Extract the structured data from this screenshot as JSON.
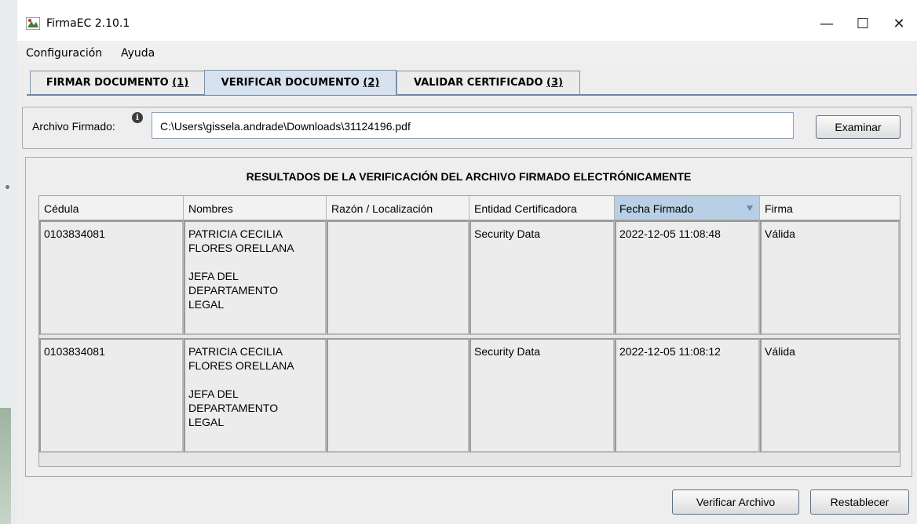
{
  "window": {
    "title": "FirmaEC 2.10.1"
  },
  "menu": {
    "configuracion": "Configuración",
    "ayuda": "Ayuda"
  },
  "tabs": [
    {
      "label": "FIRMAR DOCUMENTO",
      "shortcut": "(1)"
    },
    {
      "label": "VERIFICAR DOCUMENTO",
      "shortcut": "(2)"
    },
    {
      "label": "VALIDAR CERTIFICADO",
      "shortcut": "(3)"
    }
  ],
  "file": {
    "label": "Archivo Firmado:",
    "path": "C:\\Users\\gissela.andrade\\Downloads\\31124196.pdf",
    "browse_button": "Examinar"
  },
  "results": {
    "title": "RESULTADOS DE LA VERIFICACIÓN DEL ARCHIVO FIRMADO ELECTRÓNICAMENTE",
    "columns": [
      "Cédula",
      "Nombres",
      "Razón / Localización",
      "Entidad Certificadora",
      "Fecha Firmado",
      "Firma"
    ],
    "rows": [
      {
        "cedula": "0103834081",
        "nombre_linea1": "PATRICIA CECILIA",
        "nombre_linea2": "FLORES ORELLANA",
        "cargo_linea1": "JEFA DEL",
        "cargo_linea2": "DEPARTAMENTO",
        "cargo_linea3": "LEGAL",
        "razon": "",
        "entidad": "Security Data",
        "fecha": "2022-12-05 11:08:48",
        "firma": "Válida"
      },
      {
        "cedula": "0103834081",
        "nombre_linea1": "PATRICIA CECILIA",
        "nombre_linea2": "FLORES ORELLANA",
        "cargo_linea1": "JEFA DEL",
        "cargo_linea2": "DEPARTAMENTO",
        "cargo_linea3": "LEGAL",
        "razon": "",
        "entidad": "Security Data",
        "fecha": "2022-12-05 11:08:12",
        "firma": "Válida"
      }
    ]
  },
  "buttons": {
    "verificar": "Verificar Archivo",
    "restablecer": "Restablecer"
  }
}
